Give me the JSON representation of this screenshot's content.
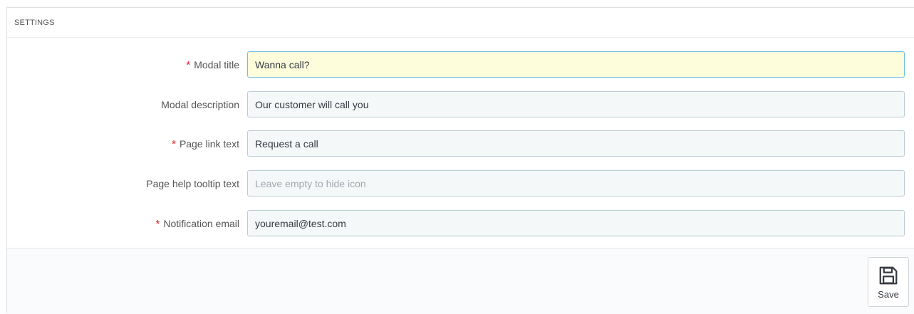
{
  "panel": {
    "heading": "SETTINGS"
  },
  "fields": [
    {
      "label": "Modal title",
      "required": true,
      "value": "Wanna call?",
      "placeholder": ""
    },
    {
      "label": "Modal description",
      "required": false,
      "value": "Our customer will call you",
      "placeholder": ""
    },
    {
      "label": "Page link text",
      "required": true,
      "value": "Request a call",
      "placeholder": ""
    },
    {
      "label": "Page help tooltip text",
      "required": false,
      "value": "",
      "placeholder": "Leave empty to hide icon"
    },
    {
      "label": "Notification email",
      "required": true,
      "value": "youremail@test.com",
      "placeholder": ""
    }
  ],
  "required_marker": "*",
  "footer": {
    "save_label": "Save",
    "save_icon": "floppy-disk-icon"
  },
  "colors": {
    "required": "#e21b23",
    "active_field_bg": "#fdfddc",
    "active_field_border": "#6dbde4",
    "field_bg": "#f5f8f9"
  }
}
